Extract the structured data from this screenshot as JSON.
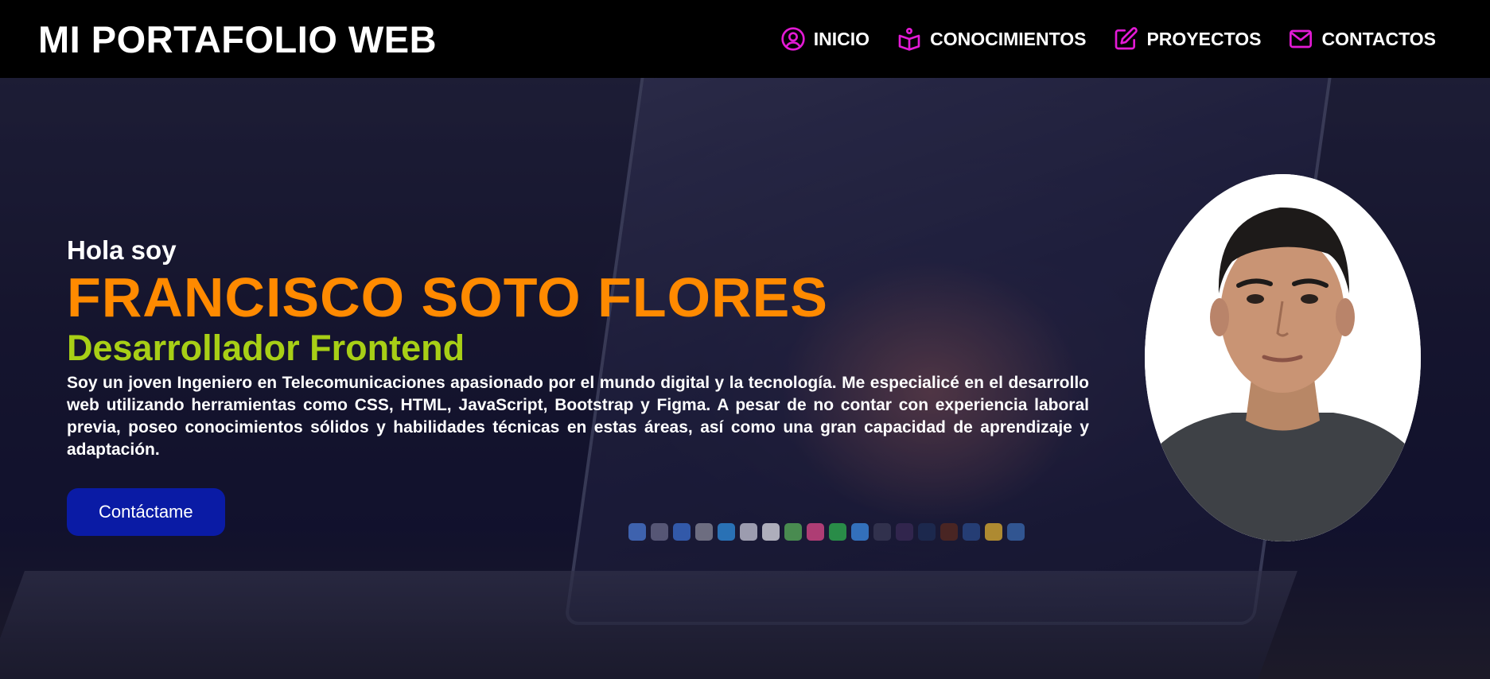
{
  "brand": {
    "title": "MI PORTAFOLIO WEB"
  },
  "nav": {
    "items": [
      {
        "label": "INICIO",
        "icon": "user-circle-icon"
      },
      {
        "label": "CONOCIMIENTOS",
        "icon": "book-open-icon"
      },
      {
        "label": "PROYECTOS",
        "icon": "edit-icon"
      },
      {
        "label": "CONTACTOS",
        "icon": "mail-icon"
      }
    ],
    "icon_color": "#e31ad5"
  },
  "hero": {
    "greeting": "Hola soy",
    "name": "FRANCISCO SOTO FLORES",
    "role": "Desarrollador Frontend",
    "bio": "Soy un joven Ingeniero en Telecomunicaciones apasionado por el mundo digital y la tecnología. Me especialicé en el desarrollo web utilizando herramientas como CSS, HTML, JavaScript, Bootstrap y Figma. A pesar de no contar con experiencia laboral previa, poseo conocimientos sólidos y habilidades técnicas en estas áreas, así como una gran capacidad de aprendizaje y adaptación.",
    "cta_label": "Contáctame"
  },
  "colors": {
    "name": "#ff8a00",
    "role": "#a8cf16",
    "cta_bg": "#0a1ba5",
    "navbar_bg": "#000000"
  }
}
